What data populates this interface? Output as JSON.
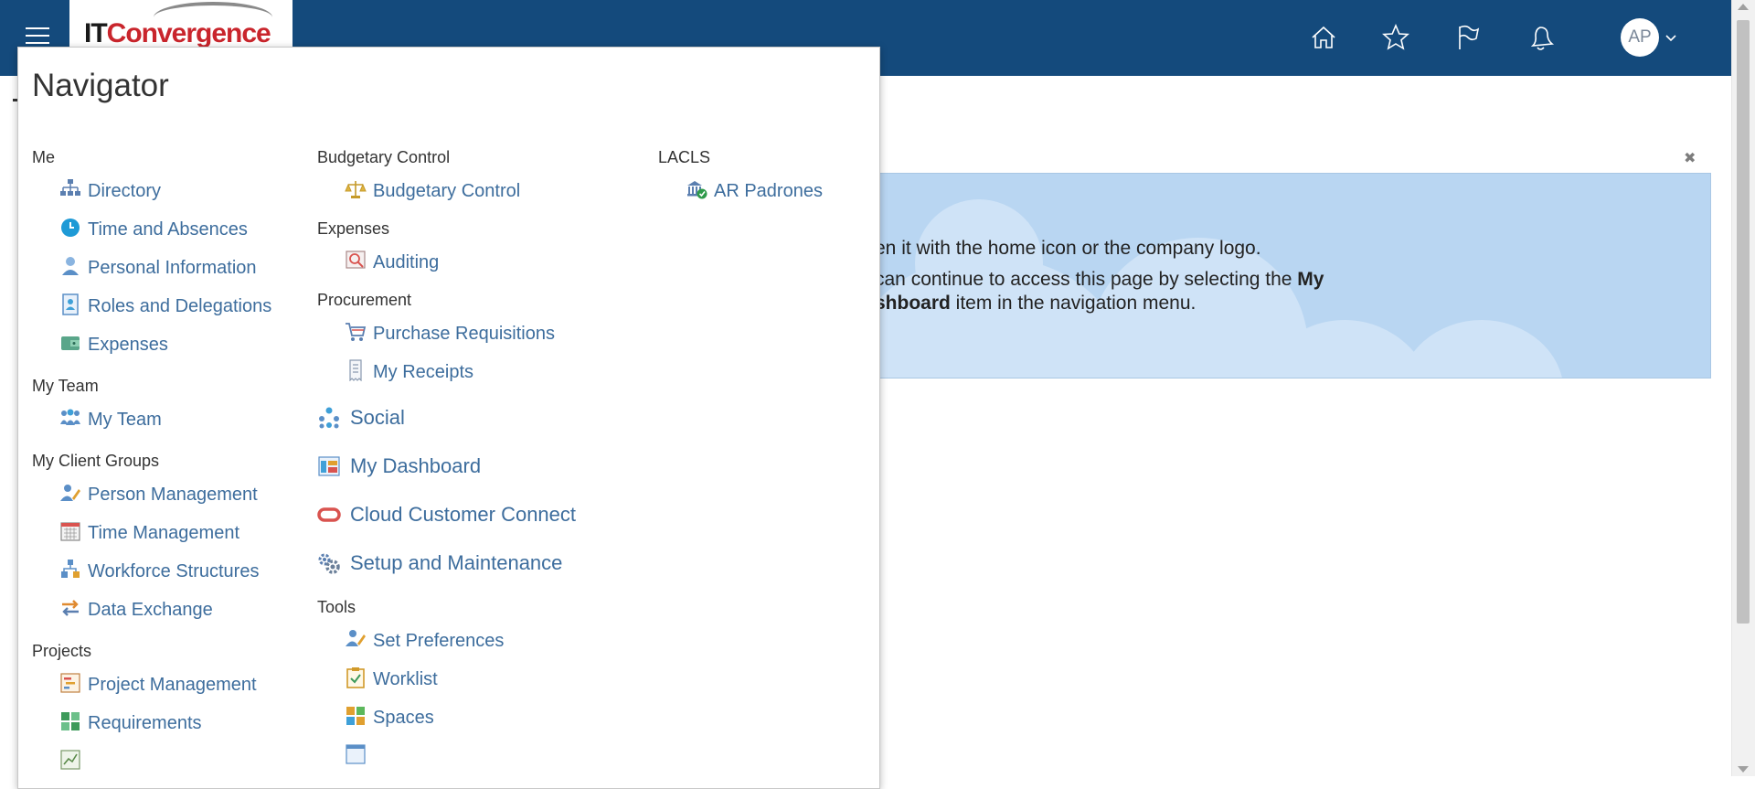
{
  "header": {
    "logo": {
      "it": "IT",
      "rest": "Convergence"
    },
    "avatar_initials": "AP",
    "icons": [
      "home-icon",
      "star-icon",
      "flag-icon",
      "bell-icon"
    ]
  },
  "banner": {
    "line1": "en it with the home icon or the company logo.",
    "line2_prefix": " can continue to access this page by selecting the ",
    "line2_bold": "My",
    "line3_bold": "shboard",
    "line3_rest": " item in the navigation menu."
  },
  "navigator": {
    "title": "Navigator",
    "col1": {
      "me": {
        "heading": "Me",
        "items": [
          "Directory",
          "Time and Absences",
          "Personal Information",
          "Roles and Delegations",
          "Expenses"
        ]
      },
      "myteam": {
        "heading": "My Team",
        "items": [
          "My Team"
        ]
      },
      "client": {
        "heading": "My Client Groups",
        "items": [
          "Person Management",
          "Time Management",
          "Workforce Structures",
          "Data Exchange"
        ]
      },
      "projects": {
        "heading": "Projects",
        "items": [
          "Project Management",
          "Requirements"
        ]
      }
    },
    "col2": {
      "budget": {
        "heading": "Budgetary Control",
        "items": [
          "Budgetary Control"
        ]
      },
      "expenses": {
        "heading": "Expenses",
        "items": [
          "Auditing"
        ]
      },
      "procurement": {
        "heading": "Procurement",
        "items": [
          "Purchase Requisitions",
          "My Receipts"
        ]
      },
      "top_level": [
        "Social",
        "My Dashboard",
        "Cloud Customer Connect",
        "Setup and Maintenance"
      ],
      "tools": {
        "heading": "Tools",
        "items": [
          "Set Preferences",
          "Worklist",
          "Spaces"
        ]
      }
    },
    "col3": {
      "lacls": {
        "heading": "LACLS",
        "items": [
          "AR Padrones"
        ]
      }
    }
  },
  "colors": {
    "header": "#144a7c",
    "link": "#3d6d9d",
    "banner": "#b9d6f2"
  }
}
